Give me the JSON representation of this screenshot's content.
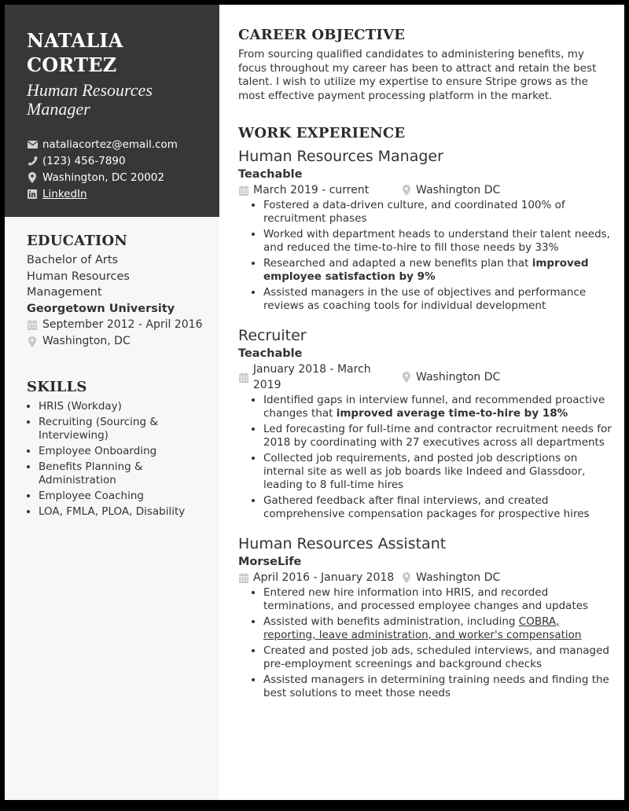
{
  "header": {
    "name_line1": "NATALIA",
    "name_line2": "CORTEZ",
    "title": "Human Resources Manager",
    "contacts": [
      {
        "icon": "envelope-icon",
        "text": "nataliacortez@email.com"
      },
      {
        "icon": "phone-icon",
        "text": "(123) 456-7890"
      },
      {
        "icon": "map-pin-icon",
        "text": "Washington, DC 20002"
      },
      {
        "icon": "linkedin-icon",
        "text": "LinkedIn"
      }
    ]
  },
  "education": {
    "heading": "EDUCATION",
    "degree": "Bachelor of Arts",
    "field_line1": "Human Resources",
    "field_line2": "Management",
    "school": "Georgetown University",
    "dates": "September 2012 - April 2016",
    "location": "Washington, DC"
  },
  "skills": {
    "heading": "SKILLS",
    "items": [
      "HRIS (Workday)",
      "Recruiting (Sourcing & Interviewing)",
      "Employee Onboarding",
      "Benefits Planning & Administration",
      "Employee Coaching",
      "LOA, FMLA, PLOA, Disability"
    ]
  },
  "objective": {
    "heading": "CAREER OBJECTIVE",
    "text": "From sourcing qualified candidates to administering benefits, my focus throughout my career has been to attract and retain the best talent. I wish to utilize my expertise to ensure Stripe grows as the most effective payment processing platform in the market."
  },
  "work": {
    "heading": "WORK EXPERIENCE",
    "jobs": [
      {
        "title": "Human Resources Manager",
        "company": "Teachable",
        "dates": "March 2019 - current",
        "location": "Washington DC",
        "bullets": [
          {
            "pre": "Fostered a data-driven culture, and coordinated 100% of recruitment phases",
            "bold": "",
            "post": ""
          },
          {
            "pre": "Worked with department heads to understand their talent needs, and reduced the time-to-hire to fill those needs by 33%",
            "bold": "",
            "post": ""
          },
          {
            "pre": "Researched and adapted a new benefits plan that ",
            "bold": "improved employee satisfaction by 9%",
            "post": ""
          },
          {
            "pre": "Assisted managers in the use of objectives and performance reviews as coaching tools for individual development",
            "bold": "",
            "post": ""
          }
        ]
      },
      {
        "title": "Recruiter",
        "company": "Teachable",
        "dates": "January 2018 - March 2019",
        "location": "Washington DC",
        "bullets": [
          {
            "pre": "Identified gaps in interview funnel, and recommended proactive changes that ",
            "bold": "improved average time-to-hire by 18%",
            "post": ""
          },
          {
            "pre": "Led forecasting for full-time and contractor recruitment needs for 2018 by coordinating with 27 executives across all departments",
            "bold": "",
            "post": ""
          },
          {
            "pre": "Collected job requirements, and posted job descriptions on internal site as well as job boards like Indeed and Glassdoor, leading to 8 full-time hires",
            "bold": "",
            "post": ""
          },
          {
            "pre": "Gathered feedback after final interviews, and created comprehensive compensation packages for prospective hires",
            "bold": "",
            "post": ""
          }
        ]
      },
      {
        "title": "Human Resources Assistant",
        "company": "MorseLife",
        "dates": "April 2016 - January 2018",
        "location": "Washington DC",
        "bullets": [
          {
            "pre": "Entered new hire information into HRIS, and recorded terminations, and processed employee changes and updates",
            "bold": "",
            "post": ""
          },
          {
            "pre": "Assisted with benefits administration, including ",
            "underline": "COBRA, reporting, leave administration, and worker's compensation",
            "bold": "",
            "post": ""
          },
          {
            "pre": "Created and posted job ads, scheduled interviews, and managed pre-employment screenings and background checks",
            "bold": "",
            "post": ""
          },
          {
            "pre": "Assisted managers in determining training needs and finding the best solutions to meet those needs",
            "bold": "",
            "post": ""
          }
        ]
      }
    ]
  }
}
